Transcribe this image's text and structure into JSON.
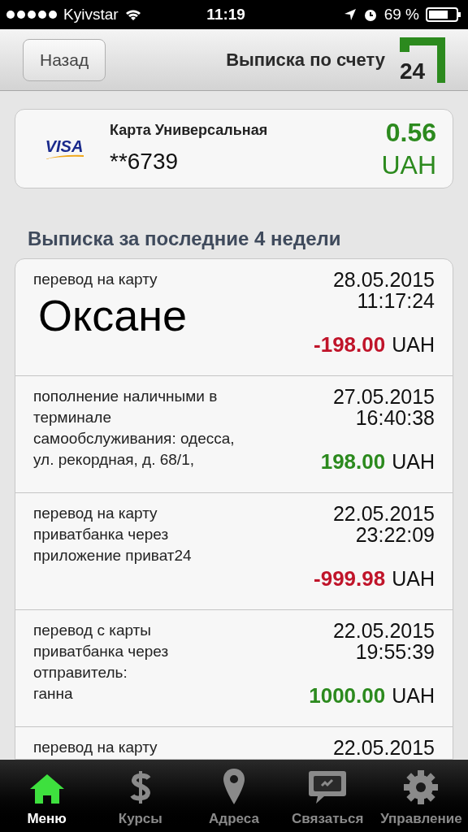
{
  "status_bar": {
    "carrier": "Kyivstar",
    "time": "11:19",
    "battery": "69 %"
  },
  "nav": {
    "back": "Назад",
    "title": "Выписка по счету",
    "logo": "24"
  },
  "card": {
    "brand": "VISA",
    "name": "Карта Универсальная",
    "number": "**6739",
    "balance": "0.56",
    "currency": "UAH"
  },
  "section_title": "Выписка за последние 4 недели",
  "transactions": [
    {
      "lines": [
        "перевод на карту"
      ],
      "overlay": "Оксане",
      "date": "28.05.2015",
      "time": "11:17:24",
      "amount": "-198.00",
      "currency": "UAH",
      "color": "#c0142a"
    },
    {
      "lines": [
        "пополнение наличными в",
        "терминале",
        "самообслуживания: одесса,",
        "ул. рекордная, д. 68/1,"
      ],
      "date": "27.05.2015",
      "time": "16:40:38",
      "amount": "198.00",
      "currency": "UAH",
      "color": "#2c8a1e"
    },
    {
      "lines": [
        "перевод на карту",
        "приватбанка через",
        "приложение приват24"
      ],
      "date": "22.05.2015",
      "time": "23:22:09",
      "amount": "-999.98",
      "currency": "UAH",
      "color": "#c0142a"
    },
    {
      "lines": [
        "перевод с карты",
        "приватбанка через",
        "отправитель:",
        "ганна"
      ],
      "date": "22.05.2015",
      "time": "19:55:39",
      "amount": "1000.00",
      "currency": "UAH",
      "color": "#2c8a1e"
    },
    {
      "lines": [
        "перевод на карту"
      ],
      "date": "22.05.2015"
    }
  ],
  "tabs": [
    {
      "label": "Меню",
      "kind": "home",
      "selected": true
    },
    {
      "label": "Курсы",
      "kind": "dollar",
      "selected": false
    },
    {
      "label": "Адреса",
      "kind": "pin",
      "selected": false
    },
    {
      "label": "Связаться",
      "kind": "chat",
      "selected": false
    },
    {
      "label": "Управление",
      "kind": "gear",
      "selected": false
    }
  ]
}
